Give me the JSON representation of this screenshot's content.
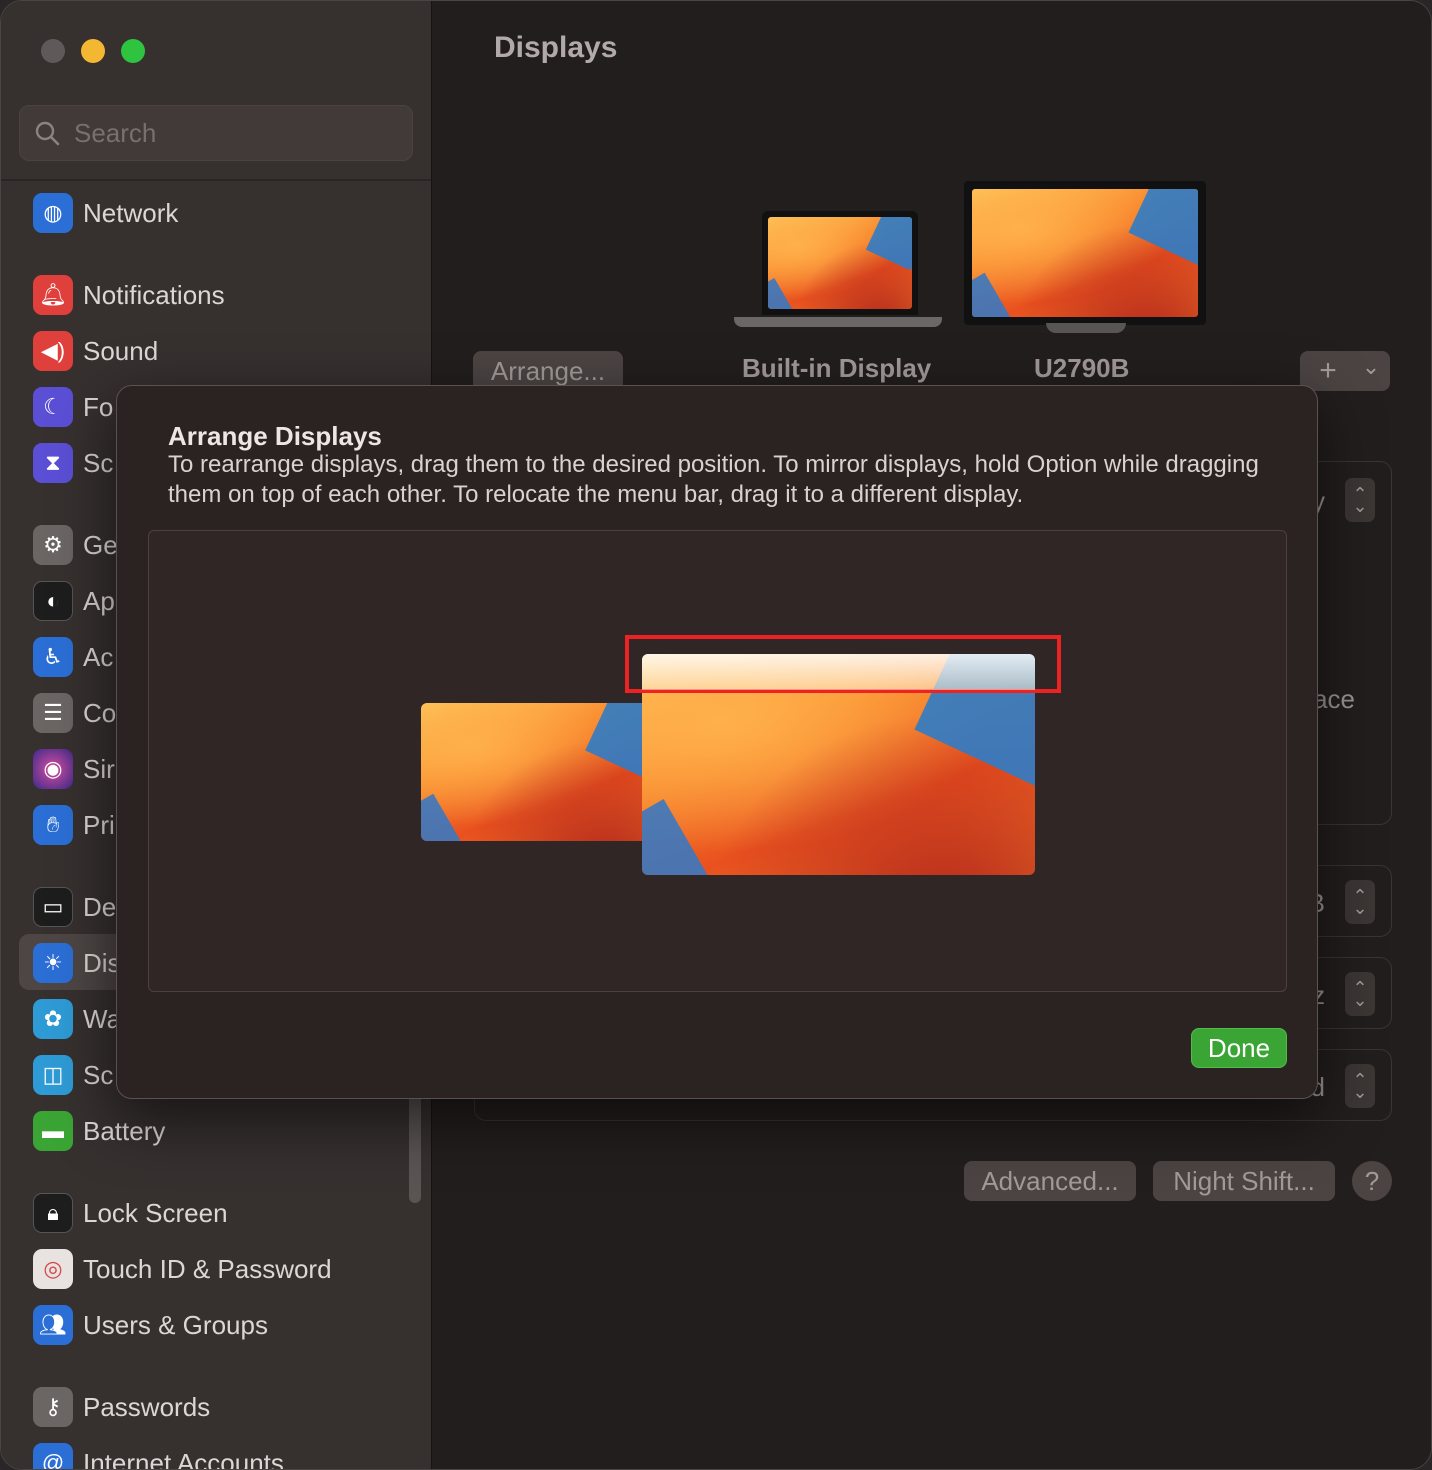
{
  "window": {
    "traffic_lights": [
      "close",
      "minimize",
      "maximize"
    ]
  },
  "sidebar": {
    "search_placeholder": "Search",
    "items": [
      {
        "label": "Network",
        "icon": "globe-icon",
        "color": "#2b6fd6"
      },
      {
        "label": "Notifications",
        "icon": "bell-icon",
        "color": "#e0403c"
      },
      {
        "label": "Sound",
        "icon": "speaker-icon",
        "color": "#e0403c"
      },
      {
        "label": "Fo",
        "icon": "moon-icon",
        "color": "#5b4fd6"
      },
      {
        "label": "Sc",
        "icon": "hourglass-icon",
        "color": "#5b4fd6"
      },
      {
        "label": "Ge",
        "icon": "gear-icon",
        "color": "#6b6564"
      },
      {
        "label": "Ap",
        "icon": "appearance-icon",
        "color": "#1d1d1d"
      },
      {
        "label": "Ac",
        "icon": "accessibility-icon",
        "color": "#2b6fd6"
      },
      {
        "label": "Co",
        "icon": "control-center-icon",
        "color": "#6b6564"
      },
      {
        "label": "Sir",
        "icon": "siri-icon",
        "color": "#8a3fb0"
      },
      {
        "label": "Pri",
        "icon": "hand-icon",
        "color": "#2b6fd6"
      },
      {
        "label": "De",
        "icon": "desktop-dock-icon",
        "color": "#1d1d1d"
      },
      {
        "label": "Dis",
        "icon": "sun-icon",
        "color": "#2b6fd6"
      },
      {
        "label": "Wa",
        "icon": "flower-icon",
        "color": "#2e9bd6"
      },
      {
        "label": "Sc",
        "icon": "screensaver-icon",
        "color": "#2e9bd6"
      },
      {
        "label": "Battery",
        "icon": "battery-icon",
        "color": "#3aa535"
      },
      {
        "label": "Lock Screen",
        "icon": "lock-icon",
        "color": "#1d1d1d"
      },
      {
        "label": "Touch ID & Password",
        "icon": "fingerprint-icon",
        "color": "#e8e2e0"
      },
      {
        "label": "Users & Groups",
        "icon": "users-icon",
        "color": "#2b6fd6"
      },
      {
        "label": "Passwords",
        "icon": "key-icon",
        "color": "#6b6564"
      },
      {
        "label": "Internet Accounts",
        "icon": "at-icon",
        "color": "#2b6fd6"
      }
    ]
  },
  "main": {
    "title": "Displays",
    "arrange_button": "Arrange...",
    "displays": [
      {
        "label": "Built-in Display"
      },
      {
        "label": "U2790B"
      }
    ],
    "add_button_symbol": "+",
    "add_button_chevron": "⌄",
    "peek_texts": [
      "y",
      "ace",
      "B",
      "z",
      "d"
    ],
    "advanced_button": "Advanced...",
    "night_shift_button": "Night Shift...",
    "help_button": "?"
  },
  "modal": {
    "title": "Arrange Displays",
    "description": "To rearrange displays, drag them to the desired position. To mirror displays, hold Option while dragging them on top of each other. To relocate the menu bar, drag it to a different display.",
    "done_button": "Done",
    "accent_color": "#3aa535",
    "highlight_color": "#ee2222"
  }
}
